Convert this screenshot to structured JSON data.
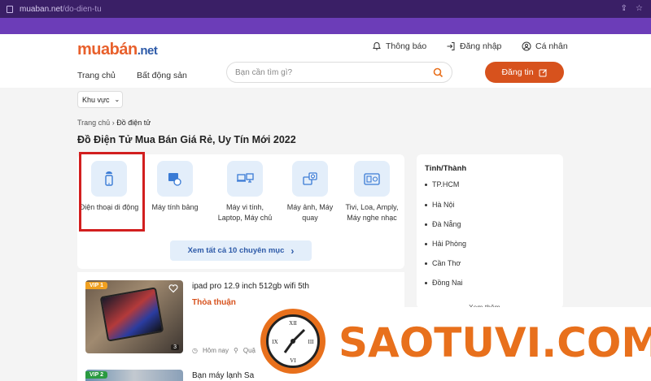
{
  "browser": {
    "url_domain": "muaban.net",
    "url_path": "/do-dien-tu"
  },
  "header": {
    "logo_main": "muabán",
    "logo_tld": ".net",
    "notifications": "Thông báo",
    "login": "Đăng nhập",
    "profile": "Cá nhân",
    "nav": [
      "Trang chủ",
      "Bất động sản"
    ],
    "search_placeholder": "Bạn cần tìm gì?",
    "post_button": "Đăng tin"
  },
  "filter": {
    "region_label": "Khu vực"
  },
  "breadcrumb": {
    "home": "Trang chủ",
    "separator": "›",
    "current": "Đồ điện tử"
  },
  "page_title": "Đồ Điện Tử Mua Bán Giá Rẻ, Uy Tín Mới 2022",
  "categories": [
    {
      "label": "Điện thoại di động",
      "icon": "android-phone-icon"
    },
    {
      "label": "Máy tính bảng",
      "icon": "tablet-icon"
    },
    {
      "label": "Máy vi tính, Laptop, Máy chủ",
      "icon": "laptop-icon"
    },
    {
      "label": "Máy ảnh, Máy quay",
      "icon": "camera-icon"
    },
    {
      "label": "Tivi, Loa, Amply, Máy nghe nhạc",
      "icon": "tv-speaker-icon"
    }
  ],
  "see_all": "Xem tất cả 10 chuyên mục",
  "provinces": {
    "title": "Tỉnh/Thành",
    "items": [
      "TP.HCM",
      "Hà Nội",
      "Đà Nẵng",
      "Hải Phòng",
      "Cần Thơ",
      "Đồng Nai"
    ],
    "more": "Xem thêm"
  },
  "listings": [
    {
      "badge": "VIP 1",
      "title": "ipad pro 12.9 inch 512gb wifi 5th",
      "price": "Thỏa thuận",
      "time": "Hôm nay",
      "location": "Quận",
      "image_count": "3"
    },
    {
      "badge": "VIP 2",
      "title": "Bạn máy lạnh Sa"
    }
  ],
  "watermark": {
    "text": "SAOTUVI.COM"
  },
  "colors": {
    "brand_orange": "#d7521d",
    "brand_blue": "#2d5aa8",
    "highlight_red": "#d21f1f",
    "chrome_purple": "#6c3db8"
  }
}
